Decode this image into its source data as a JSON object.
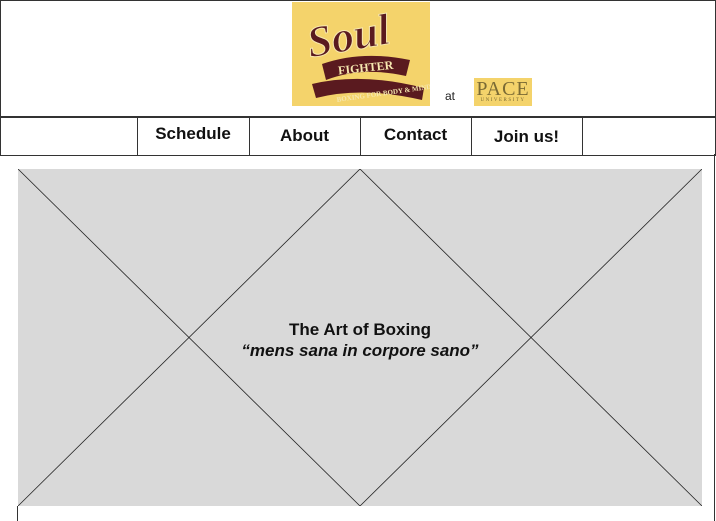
{
  "logo": {
    "line1": "Soul",
    "line2": "FIGHTER",
    "line3": "BOXING FOR BODY & MIND",
    "icon": "soul-fighter-logo"
  },
  "header": {
    "at_text": "at",
    "partner": {
      "name": "PACE",
      "subtitle": "UNIVERSITY"
    }
  },
  "nav": {
    "items": [
      {
        "label": "Schedule"
      },
      {
        "label": "About"
      },
      {
        "label": "Contact"
      },
      {
        "label": "Join us!"
      }
    ]
  },
  "hero": {
    "title": "The Art of Boxing",
    "tagline": "“mens sana in corpore sano”",
    "placeholder_icon": "image-placeholder-icon"
  },
  "colors": {
    "logo_background": "#f4d36b",
    "logo_text": "#5a1a1f",
    "placeholder_fill": "#d9d9d9"
  }
}
